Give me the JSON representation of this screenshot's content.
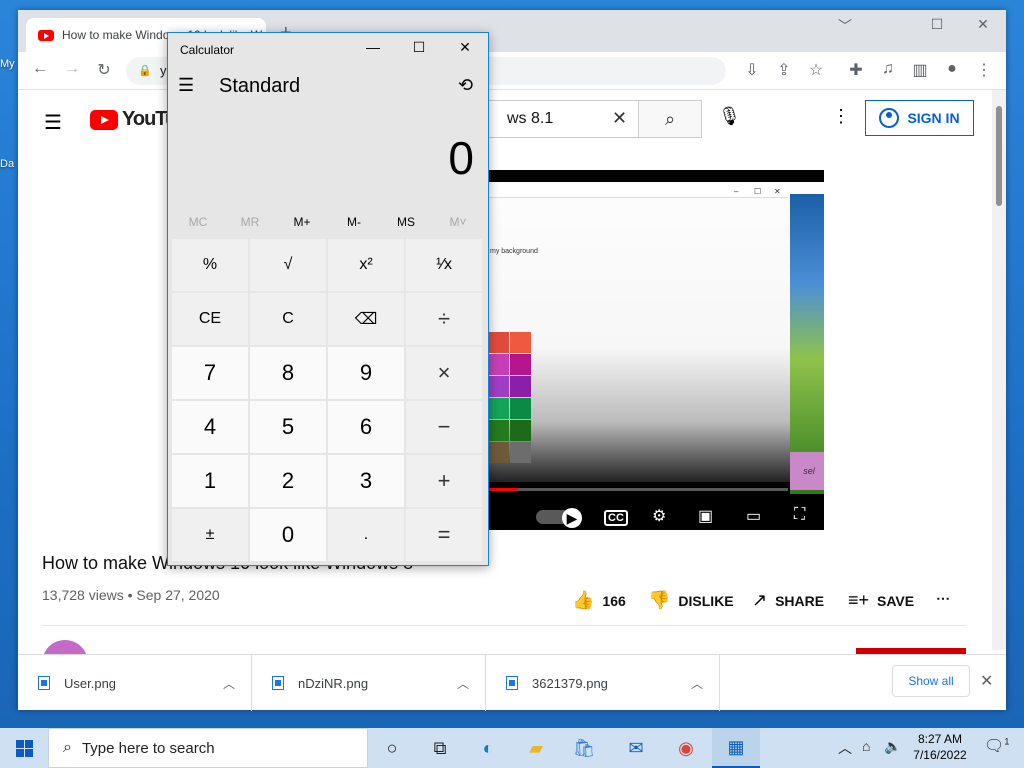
{
  "desktop": {
    "labels": [
      "My",
      "Da"
    ]
  },
  "browser": {
    "tab_title": "How to make Windows 10 look like Windows 8.1",
    "new_tab": "+",
    "address": "y",
    "window_controls": {
      "minimize": "﹀",
      "restore": "☐",
      "close": "✕"
    }
  },
  "youtube": {
    "logo_text": "YouTube",
    "search_value": "ws 8.1",
    "sign_in": "SIGN IN",
    "video_title": "How to make Windows 10 look like Windows 8",
    "views": "13,728 views",
    "date": "Sep 27, 2020",
    "likes": "166",
    "dislike": "DISLIKE",
    "share": "SHARE",
    "save": "SAVE",
    "more": "⋯",
    "video": {
      "inner_text": "my background",
      "sel_label": "sel",
      "progress": 0.1,
      "swatches": [
        "#e24a3b",
        "#f05a3c",
        "#c73fb6",
        "#b5168b",
        "#a13dc4",
        "#8c1fa8",
        "#15a35a",
        "#0b8a45",
        "#237a1f",
        "#1d6b1a",
        "#6e5a3a",
        "#6d6d6d"
      ]
    }
  },
  "downloads": {
    "items": [
      {
        "name": "User.png"
      },
      {
        "name": "nDziNR.png"
      },
      {
        "name": "3621379.png"
      }
    ],
    "show_all": "Show all"
  },
  "calculator": {
    "title": "Calculator",
    "mode": "Standard",
    "display": "0",
    "memory": [
      {
        "label": "MC",
        "enabled": false
      },
      {
        "label": "MR",
        "enabled": false
      },
      {
        "label": "M+",
        "enabled": true
      },
      {
        "label": "M-",
        "enabled": true
      },
      {
        "label": "MS",
        "enabled": true
      },
      {
        "label": "M˅",
        "enabled": false
      }
    ],
    "keys": [
      {
        "label": "%",
        "kind": "fn"
      },
      {
        "label": "√",
        "kind": "fn"
      },
      {
        "label": "x²",
        "kind": "fn"
      },
      {
        "label": "¹⁄x",
        "kind": "fn"
      },
      {
        "label": "CE",
        "kind": "fn"
      },
      {
        "label": "C",
        "kind": "fn"
      },
      {
        "label": "⌫",
        "kind": "fn"
      },
      {
        "label": "÷",
        "kind": "op"
      },
      {
        "label": "7",
        "kind": "num"
      },
      {
        "label": "8",
        "kind": "num"
      },
      {
        "label": "9",
        "kind": "num"
      },
      {
        "label": "×",
        "kind": "op"
      },
      {
        "label": "4",
        "kind": "num"
      },
      {
        "label": "5",
        "kind": "num"
      },
      {
        "label": "6",
        "kind": "num"
      },
      {
        "label": "−",
        "kind": "op"
      },
      {
        "label": "1",
        "kind": "num"
      },
      {
        "label": "2",
        "kind": "num"
      },
      {
        "label": "3",
        "kind": "num"
      },
      {
        "label": "+",
        "kind": "op"
      },
      {
        "label": "±",
        "kind": "fn"
      },
      {
        "label": "0",
        "kind": "num"
      },
      {
        "label": ".",
        "kind": "fn"
      },
      {
        "label": "=",
        "kind": "op"
      }
    ]
  },
  "taskbar": {
    "search_placeholder": "Type here to search",
    "time": "8:27 AM",
    "date": "7/16/2022",
    "notification_count": "1"
  }
}
